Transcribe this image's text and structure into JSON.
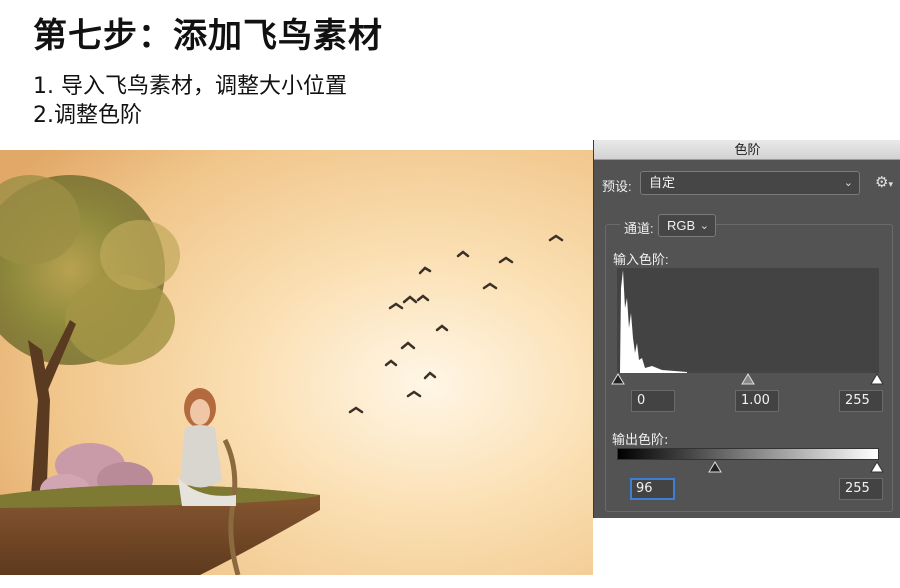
{
  "step": {
    "title": "第七步：添加飞鸟素材",
    "line1": "1. 导入飞鸟素材，调整大小位置",
    "line2": "2.调整色阶"
  },
  "levels_panel": {
    "title": "色阶",
    "preset_label": "预设:",
    "preset_value": "自定",
    "channel_label": "通道:",
    "channel_value": "RGB",
    "input_levels_label": "输入色阶:",
    "input_black": "0",
    "input_gamma": "1.00",
    "input_white": "255",
    "output_levels_label": "输出色阶:",
    "output_black": "96",
    "output_white": "255"
  }
}
